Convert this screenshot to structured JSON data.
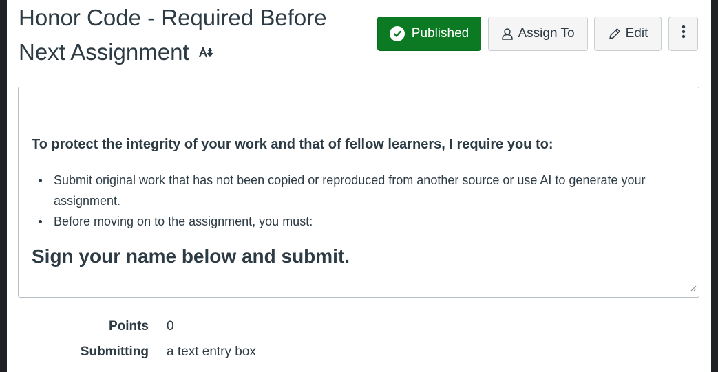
{
  "assignment": {
    "title": "Honor Code - Required Before Next Assignment"
  },
  "toolbar": {
    "published_label": "Published",
    "assign_label": "Assign To",
    "edit_label": "Edit"
  },
  "description": {
    "intro": "To protect the integrity of your work and that of fellow learners, I require you to:",
    "bullets": [
      "Submit original work that has not been copied or reproduced from another source or use AI to generate your assignment.",
      "Before moving on to the assignment, you must:"
    ],
    "sign_instruction": "Sign your name below and submit."
  },
  "details": {
    "points_label": "Points",
    "points_value": "0",
    "submitting_label": "Submitting",
    "submitting_value": "a text entry box"
  },
  "colors": {
    "published_green": "#0b7a22",
    "text": "#2d3b45",
    "border": "#c7cdd1"
  },
  "icons": {
    "published": "check-circle-icon",
    "assign": "user-icon",
    "edit": "pencil-icon",
    "more": "kebab-menu-icon",
    "title_tool": "ai-text-icon"
  }
}
